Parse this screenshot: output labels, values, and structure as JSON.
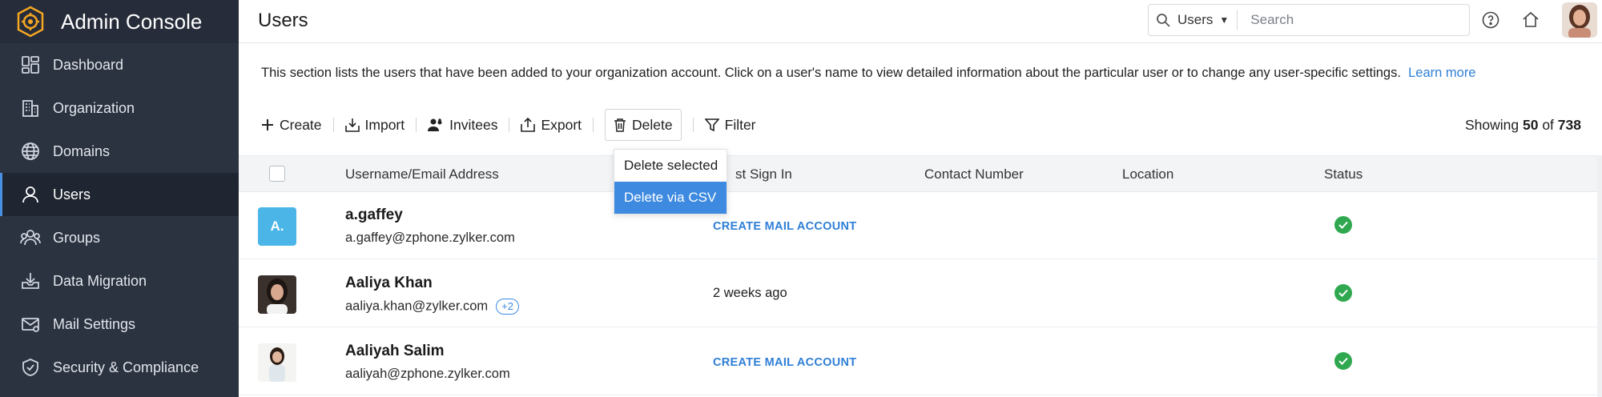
{
  "sidebar": {
    "app_title": "Admin Console",
    "items": [
      {
        "label": "Dashboard",
        "icon": "dashboard-icon"
      },
      {
        "label": "Organization",
        "icon": "building-icon"
      },
      {
        "label": "Domains",
        "icon": "globe-icon"
      },
      {
        "label": "Users",
        "icon": "user-icon",
        "active": true
      },
      {
        "label": "Groups",
        "icon": "groups-icon"
      },
      {
        "label": "Data Migration",
        "icon": "download-tray-icon"
      },
      {
        "label": "Mail Settings",
        "icon": "mail-icon"
      },
      {
        "label": "Security & Compliance",
        "icon": "shield-icon"
      }
    ]
  },
  "header": {
    "title": "Users",
    "search_scope": "Users",
    "search_placeholder": "Search"
  },
  "main": {
    "description": "This section lists the users that have been added to your organization account. Click on a user's name to view detailed information about the particular user or to change any user-specific settings.",
    "learn_more": "Learn more",
    "toolbar": {
      "create": "Create",
      "import": "Import",
      "invitees": "Invitees",
      "export": "Export",
      "delete": "Delete",
      "filter": "Filter"
    },
    "showing": {
      "prefix": "Showing",
      "count": "50",
      "of": "of",
      "total": "738"
    },
    "delete_menu": [
      "Delete selected",
      "Delete via CSV"
    ],
    "columns": [
      "Username/Email Address",
      "st Sign In",
      "Contact Number",
      "Location",
      "Status"
    ],
    "users": [
      {
        "name": "a.gaffey",
        "email": "a.gaffey@zphone.zylker.com",
        "initials": "A.",
        "sign_in": "",
        "action": "CREATE MAIL ACCOUNT",
        "extra": ""
      },
      {
        "name": "Aaliya Khan",
        "email": "aaliya.khan@zylker.com",
        "initials": "",
        "sign_in": "2 weeks ago",
        "action": "",
        "extra": "+2"
      },
      {
        "name": "Aaliyah Salim",
        "email": "aaliyah@zphone.zylker.com",
        "initials": "",
        "sign_in": "",
        "action": "CREATE MAIL ACCOUNT",
        "extra": ""
      }
    ]
  },
  "colors": {
    "sidebar_bg": "#2b3240",
    "accent": "#3d8ae0",
    "status_active": "#2fa84f",
    "initials_avatar": "#4bb5e8"
  }
}
